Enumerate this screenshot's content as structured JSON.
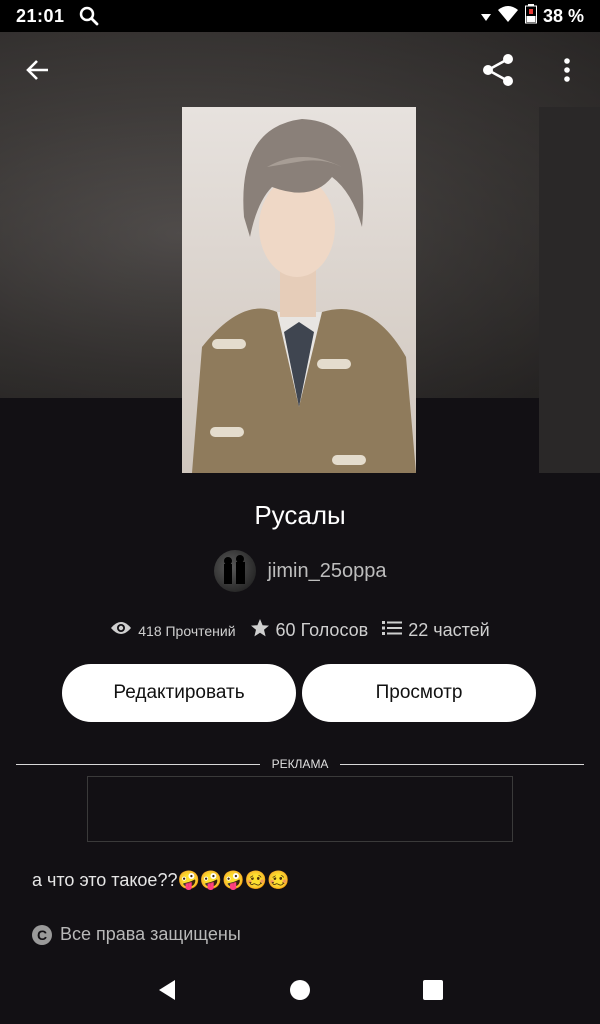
{
  "status": {
    "time": "21:01",
    "battery": "38 %"
  },
  "story": {
    "title": "Русалы",
    "author": "jimin_25oppa",
    "reads": "418 Прочтений",
    "votes": "60 Голосов",
    "parts": "22 частей",
    "description": "а что это такое??🤪🤪🤪🥴🥴"
  },
  "actions": {
    "edit_label": "Редактировать",
    "view_label": "Просмотр"
  },
  "ad": {
    "label": "РЕКЛАМА"
  },
  "footer": {
    "copyright": "Все права защищены"
  },
  "icons": {
    "back": "arrow-left-icon",
    "share": "share-icon",
    "more": "more-vert-icon",
    "reads": "eye-icon",
    "votes": "star-icon",
    "parts": "list-icon",
    "copyright": "copyright-icon"
  }
}
